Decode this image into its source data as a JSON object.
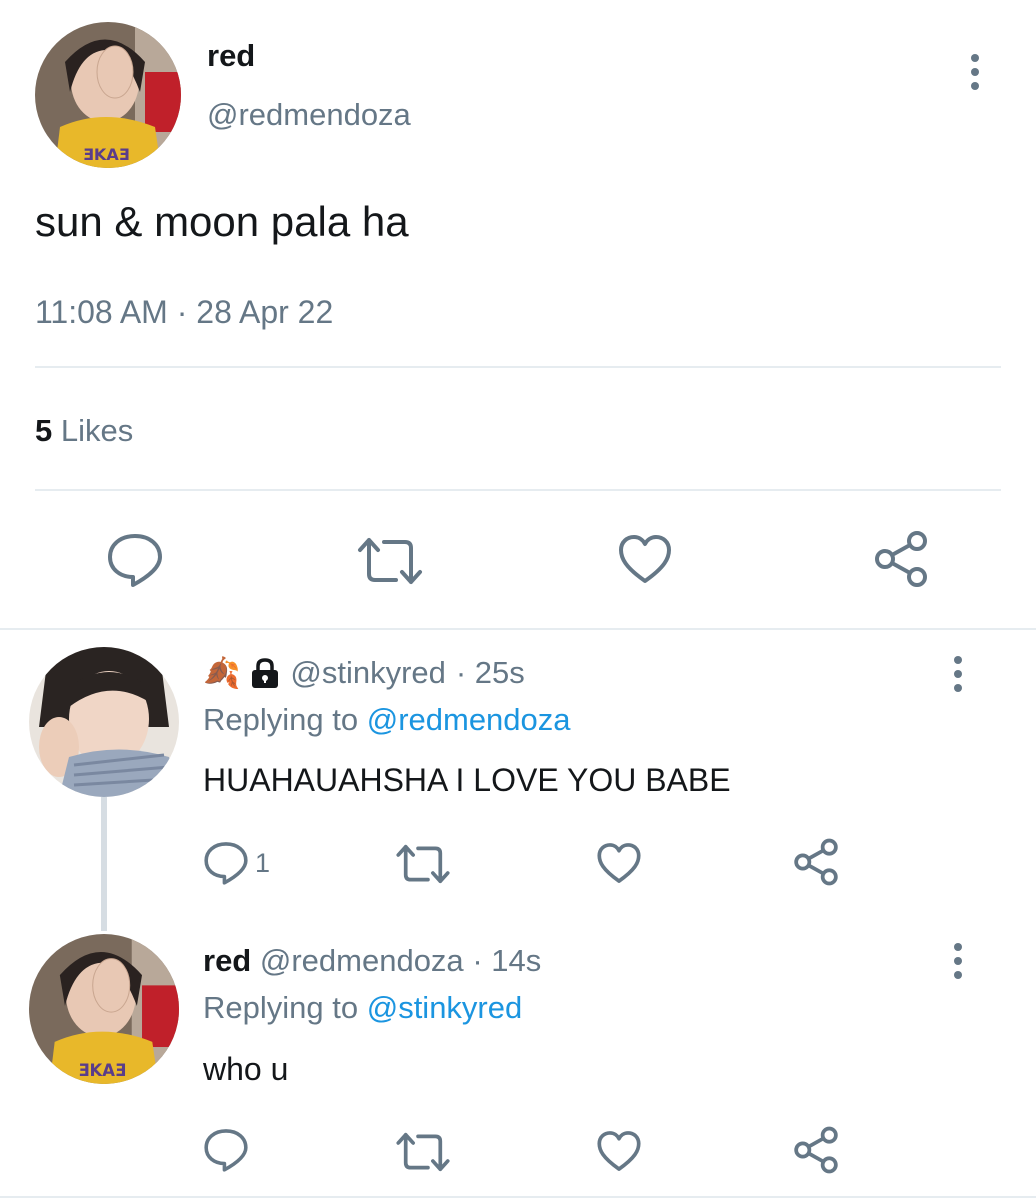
{
  "main_tweet": {
    "display_name": "red",
    "handle": "@redmendoza",
    "text": "sun & moon pala ha",
    "time": "11:08 AM",
    "separator": "·",
    "date": "28 Apr 22",
    "likes_count": "5",
    "likes_label": "Likes"
  },
  "reply1": {
    "emoji": "🍂",
    "handle": "@stinkyred",
    "age": "· 25s",
    "replying_label": "Replying to",
    "replying_handle": "@redmendoza",
    "text": "HUAHAUAHSHA I LOVE YOU BABE",
    "reply_count": "1"
  },
  "reply2": {
    "display_name": "red",
    "handle": "@redmendoza",
    "age": "· 14s",
    "replying_label": "Replying to",
    "replying_handle": "@stinkyred",
    "text": "who u"
  },
  "icons": [
    "reply-icon",
    "retweet-icon",
    "like-icon",
    "share-icon",
    "more-icon",
    "lock-icon"
  ],
  "colors": {
    "text": "#14171a",
    "secondary": "#657786",
    "link": "#1b95e0",
    "divider": "#e6ecf0"
  }
}
